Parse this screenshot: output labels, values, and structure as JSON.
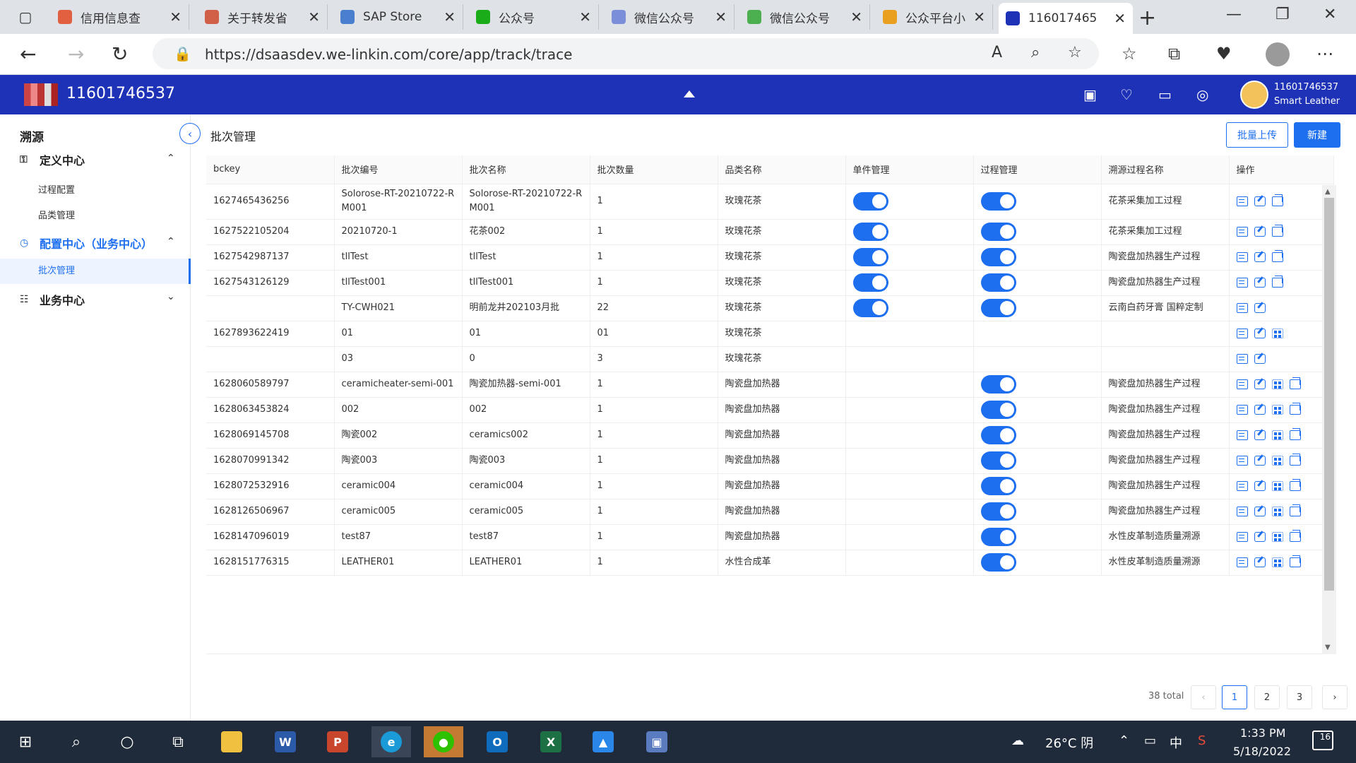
{
  "browser": {
    "tabs": [
      {
        "label": "信用信息查",
        "color": "#e06040"
      },
      {
        "label": "关于转发省",
        "color": "#d06048"
      },
      {
        "label": "SAP Store",
        "color": "#4a7fd0"
      },
      {
        "label": "公众号",
        "color": "#1aad19"
      },
      {
        "label": "微信公众号",
        "color": "#7b8fd8"
      },
      {
        "label": "微信公众号",
        "color": "#4caf50"
      },
      {
        "label": "公众平台小",
        "color": "#e9a020"
      },
      {
        "label": "116017465",
        "color": "#1e32b8"
      }
    ],
    "url": "https://dsaasdev.we-linkin.com/core/app/track/trace"
  },
  "app": {
    "title": "11601746537",
    "user_id": "11601746537",
    "user_org": "Smart Leather",
    "header_color": "#1e32b8",
    "accent_color": "#1e6ff0"
  },
  "sidebar": {
    "title": "溯源",
    "groups": [
      {
        "label": "定义中心",
        "items": [
          "过程配置",
          "品类管理"
        ]
      },
      {
        "label": "配置中心（业务中心）",
        "items": [
          "批次管理"
        ]
      },
      {
        "label": "业务中心",
        "items": []
      }
    ]
  },
  "page": {
    "title": "批次管理",
    "upload_label": "批量上传",
    "new_label": "新建"
  },
  "table": {
    "columns": [
      "bckey",
      "批次编号",
      "批次名称",
      "批次数量",
      "品类名称",
      "单件管理",
      "过程管理",
      "溯源过程名称",
      "操作"
    ],
    "rows": [
      {
        "bckey": "1627465436256",
        "code": "Solorose-RT-20210722-RM001",
        "name": "Solorose-RT-20210722-RM001",
        "qty": "1",
        "category": "玫瑰花茶",
        "unit": true,
        "process": true,
        "trace": "花茶采集加工过程",
        "ops": [
          "view",
          "edit",
          "copy"
        ]
      },
      {
        "bckey": "1627522105204",
        "code": "20210720-1",
        "name": "花茶002",
        "qty": "1",
        "category": "玫瑰花茶",
        "unit": true,
        "process": true,
        "trace": "花茶采集加工过程",
        "ops": [
          "view",
          "edit",
          "copy"
        ]
      },
      {
        "bckey": "1627542987137",
        "code": "tllTest",
        "name": "tllTest",
        "qty": "1",
        "category": "玫瑰花茶",
        "unit": true,
        "process": true,
        "trace": "陶瓷盘加热器生产过程",
        "ops": [
          "view",
          "edit",
          "copy"
        ]
      },
      {
        "bckey": "1627543126129",
        "code": "tllTest001",
        "name": "tllTest001",
        "qty": "1",
        "category": "玫瑰花茶",
        "unit": true,
        "process": true,
        "trace": "陶瓷盘加热器生产过程",
        "ops": [
          "view",
          "edit",
          "copy"
        ]
      },
      {
        "bckey": "",
        "code": "TY-CWH021",
        "name": "明前龙井202103月批",
        "qty": "22",
        "category": "玫瑰花茶",
        "unit": true,
        "process": true,
        "trace": "云南白药牙膏 国粹定制",
        "ops": [
          "view",
          "edit"
        ]
      },
      {
        "bckey": "1627893622419",
        "code": "01",
        "name": "01",
        "qty": "01",
        "category": "玫瑰花茶",
        "unit": false,
        "process": false,
        "trace": "",
        "ops": [
          "view",
          "edit",
          "qr"
        ]
      },
      {
        "bckey": "",
        "code": "03",
        "name": "0",
        "qty": "3",
        "category": "玫瑰花茶",
        "unit": false,
        "process": false,
        "trace": "",
        "ops": [
          "view",
          "edit"
        ]
      },
      {
        "bckey": "1628060589797",
        "code": "ceramicheater-semi-001",
        "name": "陶瓷加热器-semi-001",
        "qty": "1",
        "category": "陶瓷盘加热器",
        "unit": false,
        "process": true,
        "trace": "陶瓷盘加热器生产过程",
        "ops": [
          "view",
          "edit",
          "qr",
          "copy"
        ]
      },
      {
        "bckey": "1628063453824",
        "code": "002",
        "name": "002",
        "qty": "1",
        "category": "陶瓷盘加热器",
        "unit": false,
        "process": true,
        "trace": "陶瓷盘加热器生产过程",
        "ops": [
          "view",
          "edit",
          "qr",
          "copy"
        ]
      },
      {
        "bckey": "1628069145708",
        "code": "陶瓷002",
        "name": "ceramics002",
        "qty": "1",
        "category": "陶瓷盘加热器",
        "unit": false,
        "process": true,
        "trace": "陶瓷盘加热器生产过程",
        "ops": [
          "view",
          "edit",
          "qr",
          "copy"
        ]
      },
      {
        "bckey": "1628070991342",
        "code": "陶瓷003",
        "name": "陶瓷003",
        "qty": "1",
        "category": "陶瓷盘加热器",
        "unit": false,
        "process": true,
        "trace": "陶瓷盘加热器生产过程",
        "ops": [
          "view",
          "edit",
          "qr",
          "copy"
        ]
      },
      {
        "bckey": "1628072532916",
        "code": "ceramic004",
        "name": "ceramic004",
        "qty": "1",
        "category": "陶瓷盘加热器",
        "unit": false,
        "process": true,
        "trace": "陶瓷盘加热器生产过程",
        "ops": [
          "view",
          "edit",
          "qr",
          "copy"
        ]
      },
      {
        "bckey": "1628126506967",
        "code": "ceramic005",
        "name": "ceramic005",
        "qty": "1",
        "category": "陶瓷盘加热器",
        "unit": false,
        "process": true,
        "trace": "陶瓷盘加热器生产过程",
        "ops": [
          "view",
          "edit",
          "qr",
          "copy"
        ]
      },
      {
        "bckey": "1628147096019",
        "code": "test87",
        "name": "test87",
        "qty": "1",
        "category": "陶瓷盘加热器",
        "unit": false,
        "process": true,
        "trace": "水性皮革制造质量溯源",
        "ops": [
          "view",
          "edit",
          "qr",
          "copy"
        ]
      },
      {
        "bckey": "1628151776315",
        "code": "LEATHER01",
        "name": "LEATHER01",
        "qty": "1",
        "category": "水性合成革",
        "unit": false,
        "process": true,
        "trace": "水性皮革制造质量溯源",
        "ops": [
          "view",
          "edit",
          "qr",
          "copy"
        ]
      }
    ]
  },
  "pagination": {
    "total": "38 total",
    "pages": [
      "1",
      "2",
      "3"
    ],
    "current": "1"
  },
  "taskbar": {
    "weather": "26°C 阴",
    "ime": "中",
    "time": "1:33 PM",
    "date": "5/18/2022",
    "notifications": "16"
  }
}
